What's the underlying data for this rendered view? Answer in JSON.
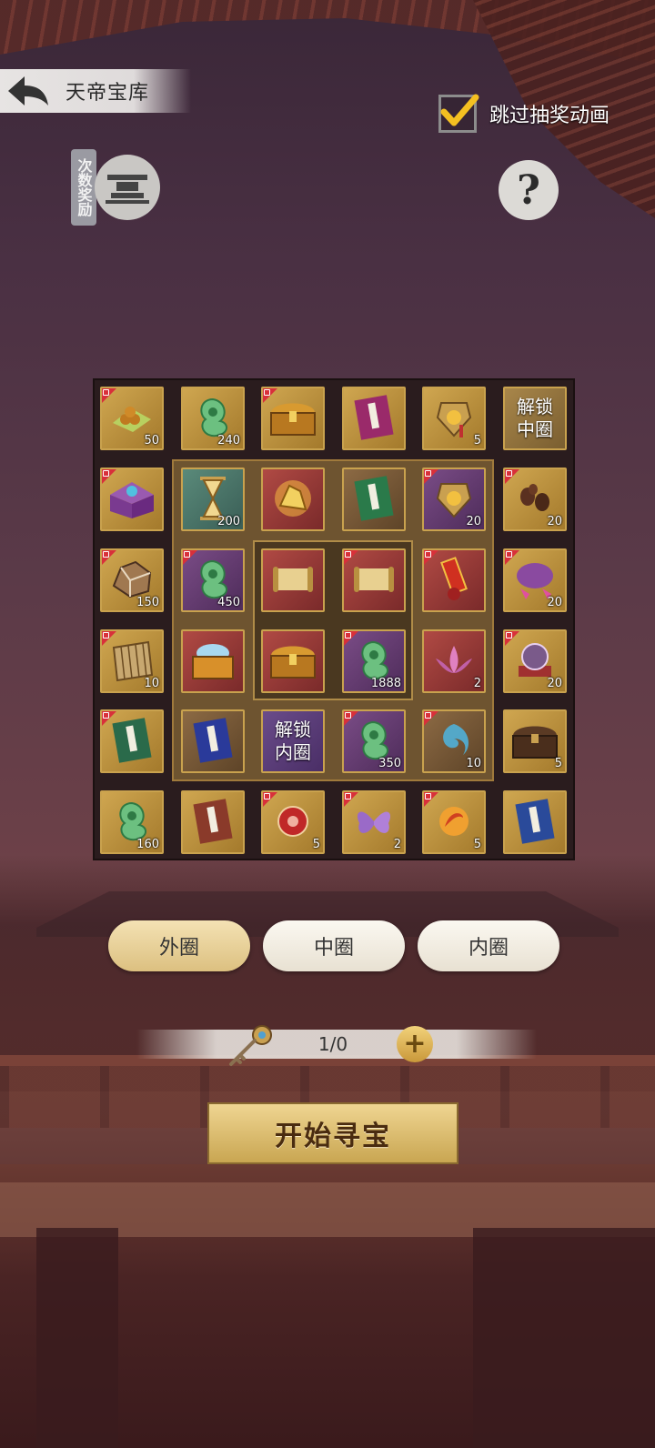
{
  "header": {
    "title": "天帝宝库"
  },
  "skip_animation": {
    "label": "跳过抽奖动画",
    "checked": true
  },
  "count_reward": {
    "label": "次数奖励"
  },
  "help": {
    "symbol": "?"
  },
  "grid": {
    "unlock_middle": "解锁\n中圈",
    "unlock_inner": "解锁\n内圈",
    "outer": [
      {
        "qty": "50"
      },
      {
        "qty": "240"
      },
      {
        "qty": ""
      },
      {
        "qty": ""
      },
      {
        "qty": "5"
      },
      {
        "qty": "20"
      },
      {
        "qty": "20"
      },
      {
        "qty": "20"
      },
      {
        "qty": "5"
      },
      {
        "qty": "5"
      },
      {
        "qty": "2"
      },
      {
        "qty": "5"
      },
      {
        "qty": ""
      },
      {
        "qty": "160"
      },
      {
        "qty": ""
      },
      {
        "qty": "10"
      },
      {
        "qty": "150"
      },
      {
        "qty": ""
      }
    ],
    "middle": [
      {
        "qty": "200"
      },
      {
        "qty": ""
      },
      {
        "qty": ""
      },
      {
        "qty": "20"
      },
      {
        "qty": ""
      },
      {
        "qty": "2"
      },
      {
        "qty": "10"
      },
      {
        "qty": "350"
      },
      {
        "qty": ""
      },
      {
        "qty": ""
      },
      {
        "qty": "450"
      }
    ],
    "inner": [
      {
        "qty": ""
      },
      {
        "qty": ""
      },
      {
        "qty": ""
      },
      {
        "qty": "1888"
      }
    ]
  },
  "tabs": [
    {
      "label": "外圈",
      "active": true
    },
    {
      "label": "中圈",
      "active": false
    },
    {
      "label": "内圈",
      "active": false
    }
  ],
  "keys": {
    "count": "1/0",
    "plus": "+"
  },
  "start_button": {
    "label": "开始寻宝"
  },
  "colors": {
    "accent_gold": "#c9a24e",
    "lock_red": "#d8303a"
  }
}
